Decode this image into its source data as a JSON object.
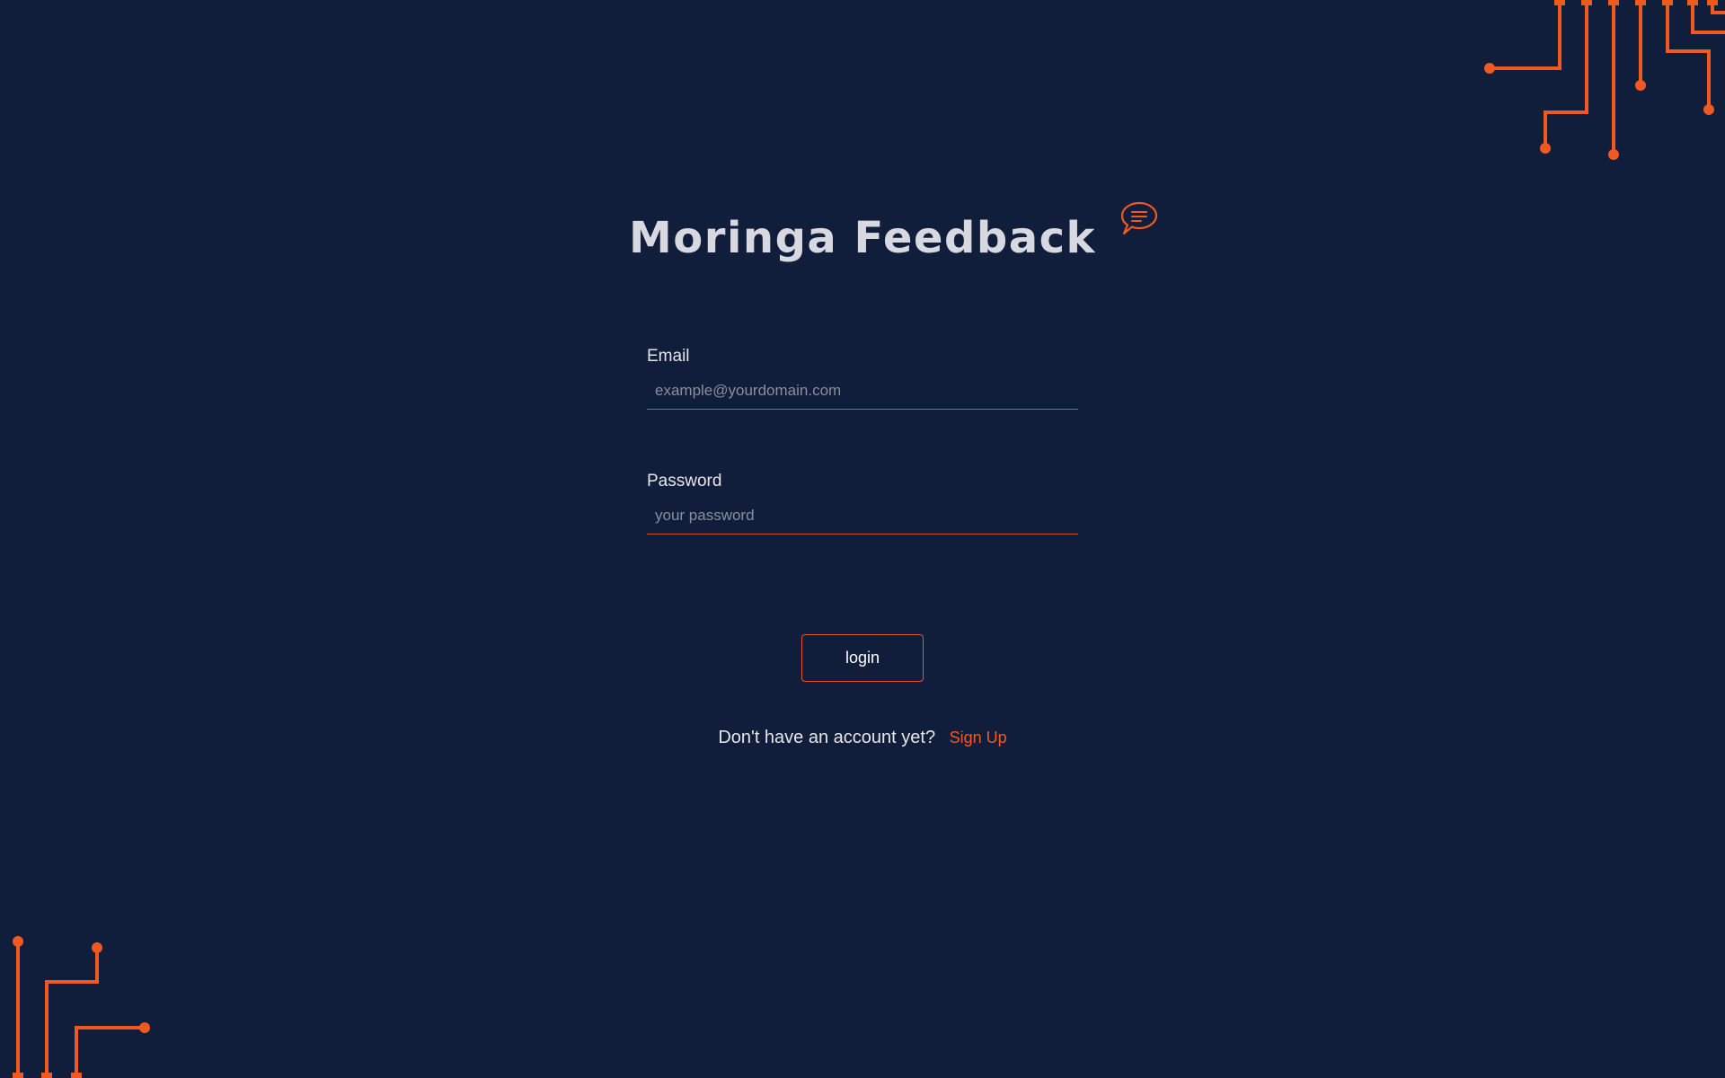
{
  "app": {
    "title": "Moringa Feedback",
    "title_icon": "chat-bubble-icon"
  },
  "form": {
    "email": {
      "label": "Email",
      "placeholder": "example@yourdomain.com",
      "value": ""
    },
    "password": {
      "label": "Password",
      "placeholder": "your password",
      "value": ""
    },
    "submit_label": "login"
  },
  "signup": {
    "prompt": "Don't have an account yet?",
    "link_label": "Sign Up"
  },
  "decorations": {
    "top_right": "circuit-lines-icon",
    "bottom_left": "circuit-lines-icon"
  },
  "colors": {
    "background": "#101e3b",
    "accent": "#f05a22",
    "text": "#e6e6ea",
    "placeholder": "#8a8f9c"
  }
}
